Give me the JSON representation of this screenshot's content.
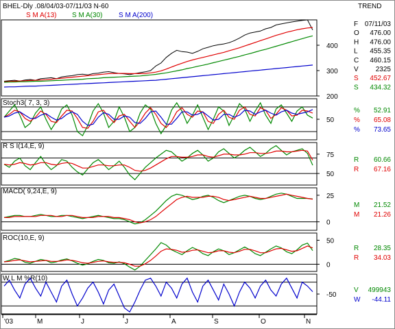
{
  "header": {
    "title": "BHEL-Dly .08/04/03-07/11/03  N-60",
    "trend": "TREND",
    "sma13": "S M A(13)",
    "sma30": "S M A(30)",
    "sma200": "S M A(200)"
  },
  "colors": {
    "price": "#000000",
    "sma13": "#e00000",
    "sma30": "#008800",
    "sma200": "#0000cc",
    "stoch_k": "#008800",
    "stoch_d": "#e00000",
    "stoch_ds": "#0000cc",
    "wlm": "#0000cc"
  },
  "x_labels": [
    "'03",
    "M",
    "J",
    "J",
    "A",
    "S",
    "O",
    "N"
  ],
  "info": [
    {
      "k": "F",
      "v": "07/11/03",
      "color": "#000000"
    },
    {
      "k": "O",
      "v": "476.00",
      "color": "#000000"
    },
    {
      "k": "H",
      "v": "476.00",
      "color": "#000000"
    },
    {
      "k": "L",
      "v": "455.35",
      "color": "#000000"
    },
    {
      "k": "C",
      "v": "460.15",
      "color": "#000000"
    },
    {
      "k": "V",
      "v": "2325",
      "color": "#000000"
    },
    {
      "k": "S",
      "v": "452.67",
      "color": "#e00000"
    },
    {
      "k": "S",
      "v": "434.32",
      "color": "#008800"
    }
  ],
  "chart_data": [
    {
      "type": "line",
      "name": "price",
      "ylim": [
        200,
        500
      ],
      "yticks": [
        200,
        300,
        400
      ],
      "series": [
        {
          "name": "Close",
          "values": [
            258,
            260,
            262,
            259,
            263,
            265,
            262,
            268,
            270,
            272,
            268,
            275,
            278,
            280,
            284,
            286,
            283,
            288,
            290,
            294,
            296,
            292,
            289,
            287,
            284,
            288,
            292,
            295,
            300,
            318,
            330,
            352,
            368,
            380,
            375,
            373,
            368,
            376,
            386,
            392,
            398,
            402,
            405,
            410,
            418,
            428,
            440,
            448,
            452,
            456,
            465,
            470,
            480,
            484,
            488,
            492,
            495,
            498,
            500,
            460
          ]
        },
        {
          "name": "S M A(13)",
          "values": [
            256,
            257,
            258,
            259,
            260,
            261,
            262,
            263,
            264,
            266,
            268,
            270,
            272,
            274,
            276,
            278,
            280,
            282,
            284,
            286,
            288,
            289,
            289,
            289,
            288,
            288,
            288,
            289,
            291,
            294,
            299,
            306,
            314,
            322,
            329,
            336,
            342,
            347,
            352,
            357,
            362,
            367,
            372,
            378,
            384,
            390,
            397,
            404,
            411,
            418,
            425,
            432,
            439,
            445,
            451,
            456,
            461,
            465,
            468,
            470
          ]
        },
        {
          "name": "S M A(30)",
          "values": [
            254,
            255,
            255,
            256,
            256,
            257,
            258,
            258,
            259,
            260,
            261,
            262,
            263,
            264,
            265,
            266,
            268,
            269,
            270,
            272,
            273,
            274,
            275,
            276,
            277,
            278,
            279,
            281,
            283,
            285,
            288,
            291,
            295,
            299,
            303,
            308,
            312,
            317,
            321,
            326,
            331,
            336,
            341,
            346,
            351,
            356,
            362,
            367,
            373,
            379,
            384,
            390,
            396,
            402,
            408,
            414,
            420,
            426,
            432,
            437
          ]
        },
        {
          "name": "S M A(200)",
          "values": [
            235,
            236,
            236,
            237,
            238,
            239,
            239,
            240,
            241,
            242,
            243,
            244,
            245,
            246,
            247,
            248,
            249,
            250,
            251,
            252,
            253,
            254,
            255,
            256,
            257,
            258,
            259,
            260,
            261,
            262,
            264,
            266,
            268,
            270,
            272,
            274,
            276,
            278,
            280,
            282,
            284,
            286,
            288,
            290,
            292,
            294,
            296,
            298,
            300,
            302,
            304,
            306,
            308,
            310,
            312,
            314,
            316,
            318,
            320,
            322
          ]
        }
      ]
    },
    {
      "type": "line",
      "name": "Stoch3( 7, 3, 3)",
      "ylim": [
        0,
        100
      ],
      "yticks": [
        50
      ],
      "refs": [
        20,
        80
      ],
      "series": [
        {
          "name": "%K",
          "values": [
            55,
            70,
            85,
            60,
            30,
            40,
            65,
            80,
            50,
            25,
            45,
            75,
            85,
            60,
            20,
            10,
            35,
            70,
            88,
            65,
            30,
            45,
            80,
            55,
            20,
            30,
            65,
            85,
            75,
            40,
            15,
            35,
            72,
            90,
            70,
            40,
            60,
            85,
            55,
            25,
            50,
            80,
            70,
            35,
            60,
            88,
            75,
            45,
            70,
            90,
            60,
            40,
            75,
            85,
            65,
            45,
            70,
            80,
            60,
            52.91
          ]
        },
        {
          "name": "%D",
          "values": [
            55,
            62,
            72,
            68,
            52,
            45,
            55,
            70,
            62,
            45,
            42,
            58,
            72,
            70,
            52,
            30,
            28,
            45,
            68,
            72,
            55,
            42,
            58,
            62,
            45,
            30,
            45,
            65,
            78,
            62,
            40,
            30,
            45,
            68,
            78,
            62,
            55,
            70,
            68,
            45,
            40,
            62,
            72,
            55,
            50,
            72,
            80,
            62,
            58,
            78,
            72,
            52,
            62,
            78,
            72,
            58,
            60,
            72,
            70,
            65.08
          ]
        },
        {
          "name": "%DS",
          "values": [
            55,
            58,
            65,
            68,
            60,
            52,
            52,
            60,
            64,
            55,
            48,
            52,
            62,
            68,
            62,
            45,
            35,
            38,
            55,
            66,
            62,
            50,
            50,
            58,
            55,
            42,
            40,
            52,
            68,
            70,
            55,
            38,
            38,
            52,
            68,
            68,
            60,
            62,
            68,
            58,
            48,
            50,
            62,
            62,
            55,
            60,
            72,
            70,
            62,
            68,
            72,
            65,
            60,
            68,
            72,
            65,
            62,
            65,
            68,
            73.65
          ]
        }
      ]
    },
    {
      "type": "line",
      "name": "R S I(14,E, 9)",
      "ylim": [
        35,
        90
      ],
      "yticks": [
        50,
        75
      ],
      "refs": [
        50,
        70
      ],
      "series": [
        {
          "name": "RSI",
          "values": [
            62,
            58,
            66,
            70,
            60,
            55,
            64,
            72,
            62,
            55,
            60,
            68,
            66,
            58,
            52,
            48,
            56,
            64,
            68,
            62,
            55,
            60,
            66,
            58,
            48,
            42,
            50,
            58,
            64,
            70,
            75,
            80,
            78,
            72,
            66,
            70,
            76,
            80,
            74,
            66,
            70,
            78,
            82,
            76,
            70,
            74,
            80,
            84,
            78,
            72,
            76,
            82,
            86,
            80,
            74,
            78,
            80,
            82,
            76,
            60.66
          ]
        },
        {
          "name": "Signal",
          "values": [
            62,
            61,
            62,
            64,
            63,
            61,
            62,
            64,
            64,
            62,
            61,
            63,
            64,
            63,
            60,
            57,
            57,
            59,
            61,
            61,
            60,
            60,
            61,
            61,
            58,
            54,
            53,
            54,
            57,
            61,
            65,
            69,
            72,
            72,
            71,
            71,
            72,
            74,
            74,
            72,
            71,
            73,
            75,
            75,
            74,
            74,
            75,
            77,
            77,
            76,
            76,
            77,
            79,
            79,
            78,
            78,
            79,
            80,
            79,
            67.16
          ]
        }
      ]
    },
    {
      "type": "line",
      "name": "MACD( 9,24,E, 9)",
      "ylim": [
        -8,
        32
      ],
      "yticks": [
        0,
        25
      ],
      "refs": [
        0
      ],
      "series": [
        {
          "name": "MACD",
          "values": [
            4,
            5,
            6,
            6,
            5,
            5,
            6,
            7,
            6,
            5,
            5,
            6,
            6,
            5,
            4,
            3,
            4,
            5,
            6,
            5,
            4,
            3,
            3,
            2,
            0,
            -2,
            -1,
            2,
            6,
            10,
            15,
            20,
            24,
            26,
            25,
            23,
            21,
            22,
            24,
            25,
            23,
            20,
            18,
            20,
            22,
            24,
            25,
            24,
            22,
            21,
            22,
            24,
            26,
            27,
            26,
            24,
            22,
            22,
            22,
            21.52
          ]
        },
        {
          "name": "Signal",
          "values": [
            4,
            4,
            5,
            5,
            5,
            5,
            5,
            6,
            6,
            6,
            5,
            5,
            6,
            6,
            5,
            4,
            4,
            4,
            5,
            5,
            5,
            4,
            4,
            3,
            2,
            0,
            -1,
            0,
            2,
            5,
            9,
            13,
            17,
            21,
            23,
            24,
            23,
            23,
            23,
            24,
            24,
            23,
            21,
            20,
            21,
            22,
            23,
            24,
            23,
            22,
            22,
            23,
            24,
            25,
            26,
            25,
            24,
            23,
            22,
            21.26
          ]
        }
      ]
    },
    {
      "type": "line",
      "name": "ROC(10,E, 9)",
      "ylim": [
        -15,
        65
      ],
      "yticks": [
        0,
        50
      ],
      "refs": [
        0
      ],
      "series": [
        {
          "name": "ROC",
          "values": [
            5,
            8,
            12,
            10,
            4,
            2,
            6,
            10,
            8,
            3,
            5,
            9,
            11,
            7,
            2,
            -2,
            1,
            6,
            10,
            8,
            3,
            2,
            5,
            1,
            -6,
            -12,
            -4,
            8,
            20,
            32,
            45,
            40,
            30,
            25,
            20,
            28,
            35,
            30,
            22,
            18,
            26,
            32,
            28,
            20,
            24,
            30,
            36,
            30,
            22,
            18,
            25,
            32,
            38,
            34,
            26,
            22,
            30,
            40,
            44,
            28.35
          ]
        },
        {
          "name": "Signal",
          "values": [
            5,
            6,
            8,
            9,
            7,
            5,
            6,
            7,
            8,
            6,
            6,
            7,
            9,
            8,
            6,
            3,
            2,
            4,
            6,
            7,
            5,
            4,
            4,
            3,
            0,
            -4,
            -4,
            1,
            8,
            17,
            27,
            32,
            31,
            29,
            25,
            26,
            29,
            30,
            27,
            24,
            25,
            28,
            28,
            25,
            24,
            27,
            31,
            31,
            28,
            24,
            24,
            28,
            32,
            33,
            30,
            27,
            28,
            33,
            38,
            34.03
          ]
        }
      ]
    },
    {
      "type": "line",
      "name": "W L M %R(10)",
      "ylim": [
        -100,
        0
      ],
      "yticks": [
        -50
      ],
      "refs": [
        -20,
        -80
      ],
      "series": [
        {
          "name": "%R",
          "values": [
            -30,
            -15,
            -40,
            -60,
            -25,
            -10,
            -35,
            -55,
            -20,
            -45,
            -70,
            -30,
            -15,
            -50,
            -80,
            -60,
            -35,
            -20,
            -45,
            -75,
            -40,
            -25,
            -55,
            -85,
            -95,
            -70,
            -40,
            -15,
            -10,
            -30,
            -55,
            -20,
            -35,
            -60,
            -25,
            -10,
            -45,
            -70,
            -30,
            -15,
            -40,
            -65,
            -25,
            -50,
            -80,
            -45,
            -20,
            -35,
            -60,
            -30,
            -15,
            -40,
            -55,
            -25,
            -10,
            -35,
            -60,
            -20,
            -30,
            -44.11
          ]
        }
      ]
    }
  ],
  "panel_labels": [
    {
      "items": [
        {
          "k": "%",
          "v": "52.91",
          "color": "#008800"
        },
        {
          "k": "%",
          "v": "65.08",
          "color": "#e00000"
        },
        {
          "k": "%",
          "v": "73.65",
          "color": "#0000cc"
        }
      ]
    },
    {
      "items": [
        {
          "k": "R",
          "v": "60.66",
          "color": "#008800"
        },
        {
          "k": "R",
          "v": "67.16",
          "color": "#e00000"
        }
      ]
    },
    {
      "items": [
        {
          "k": "M",
          "v": "21.52",
          "color": "#008800"
        },
        {
          "k": "M",
          "v": "21.26",
          "color": "#e00000"
        }
      ]
    },
    {
      "items": [
        {
          "k": "R",
          "v": "28.35",
          "color": "#008800"
        },
        {
          "k": "R",
          "v": "34.03",
          "color": "#e00000"
        }
      ]
    },
    {
      "items": [
        {
          "k": "V",
          "v": "499943",
          "color": "#008800"
        },
        {
          "k": "W",
          "v": "-44.11",
          "color": "#0000cc"
        }
      ]
    }
  ]
}
